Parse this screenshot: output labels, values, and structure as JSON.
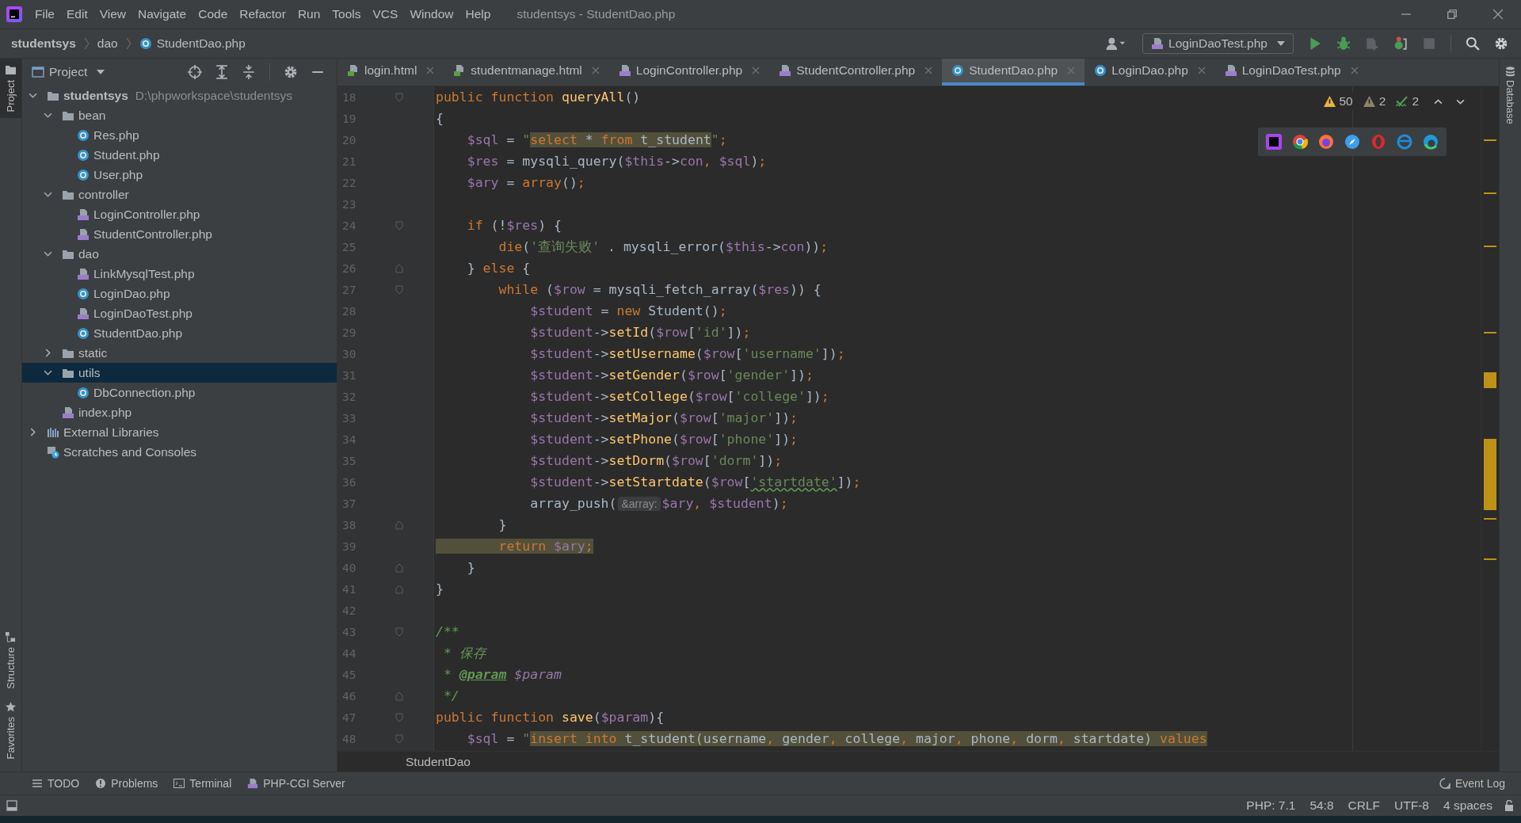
{
  "window": {
    "menu": [
      "File",
      "Edit",
      "View",
      "Navigate",
      "Code",
      "Refactor",
      "Run",
      "Tools",
      "VCS",
      "Window",
      "Help"
    ],
    "title": "studentsys - StudentDao.php"
  },
  "navbar": {
    "breadcrumbs": [
      {
        "label": "studentsys",
        "kind": "project"
      },
      {
        "label": "dao",
        "kind": "folder"
      },
      {
        "label": "StudentDao.php",
        "kind": "class"
      }
    ],
    "run_config": "LoginDaoTest.php"
  },
  "left_strip": [
    {
      "label": "Project",
      "kind": "project",
      "selected": true
    },
    {
      "label": "Structure",
      "kind": "structure",
      "selected": false
    },
    {
      "label": "Favorites",
      "kind": "favorites",
      "selected": false
    }
  ],
  "right_strip": [
    {
      "label": "Database",
      "kind": "database"
    }
  ],
  "project_panel": {
    "title": "Project",
    "tree": [
      {
        "label": "studentsys",
        "hint": "D:\\phpworkspace\\studentsys",
        "kind": "folder",
        "expanded": true,
        "selected": false,
        "children": [
          {
            "label": "bean",
            "kind": "folder",
            "expanded": true,
            "selected": false,
            "children": [
              {
                "label": "Res.php",
                "kind": "class",
                "selected": false
              },
              {
                "label": "Student.php",
                "kind": "class",
                "selected": false
              },
              {
                "label": "User.php",
                "kind": "class",
                "selected": false
              }
            ]
          },
          {
            "label": "controller",
            "kind": "folder",
            "expanded": true,
            "selected": false,
            "children": [
              {
                "label": "LoginController.php",
                "kind": "php",
                "selected": false
              },
              {
                "label": "StudentController.php",
                "kind": "php",
                "selected": false
              }
            ]
          },
          {
            "label": "dao",
            "kind": "folder",
            "expanded": true,
            "selected": false,
            "children": [
              {
                "label": "LinkMysqlTest.php",
                "kind": "php",
                "selected": false
              },
              {
                "label": "LoginDao.php",
                "kind": "class",
                "selected": false
              },
              {
                "label": "LoginDaoTest.php",
                "kind": "php",
                "selected": false
              },
              {
                "label": "StudentDao.php",
                "kind": "class",
                "selected": false
              }
            ]
          },
          {
            "label": "static",
            "kind": "folder",
            "expanded": false,
            "selected": false
          },
          {
            "label": "utils",
            "kind": "folder",
            "expanded": true,
            "selected": true,
            "children": [
              {
                "label": "DbConnection.php",
                "kind": "class",
                "selected": false
              }
            ]
          },
          {
            "label": "index.php",
            "kind": "php",
            "selected": false
          }
        ]
      },
      {
        "label": "External Libraries",
        "kind": "libraries",
        "expanded": false,
        "selected": false
      },
      {
        "label": "Scratches and Consoles",
        "kind": "scratches",
        "selected": false
      }
    ]
  },
  "editor_tabs": [
    {
      "label": "login.html",
      "kind": "html",
      "selected": false
    },
    {
      "label": "studentmanage.html",
      "kind": "html",
      "selected": false
    },
    {
      "label": "LoginController.php",
      "kind": "php",
      "selected": false
    },
    {
      "label": "StudentController.php",
      "kind": "php",
      "selected": false
    },
    {
      "label": "StudentDao.php",
      "kind": "class",
      "selected": true
    },
    {
      "label": "LoginDao.php",
      "kind": "class",
      "selected": false
    },
    {
      "label": "LoginDaoTest.php",
      "kind": "php",
      "selected": false
    }
  ],
  "inspections": [
    {
      "kind": "warning",
      "count": "50"
    },
    {
      "kind": "weak",
      "count": "2"
    },
    {
      "kind": "typo",
      "count": "2"
    }
  ],
  "code": [
    {
      "number": "18",
      "fold_start": true,
      "tokens": [
        {
          "text": "public",
          "kind": "kw"
        },
        {
          "text": " function",
          "kind": "kw"
        },
        {
          "text": " queryAll",
          "kind": "fn"
        },
        {
          "text": "()"
        }
      ]
    },
    {
      "number": "19",
      "tokens": [
        {
          "text": "{"
        }
      ]
    },
    {
      "number": "20",
      "tokens": [
        {
          "text": "    $sql",
          "kind": "var"
        },
        {
          "text": " = "
        },
        {
          "text": "\"",
          "kind": "str"
        },
        {
          "text": "select",
          "kind": "kw",
          "hl": true
        },
        {
          "text": " * ",
          "hl": true
        },
        {
          "text": "from",
          "kind": "kw",
          "hl": true
        },
        {
          "text": " t_student",
          "hl": true
        },
        {
          "text": "\"",
          "kind": "str"
        },
        {
          "text": ";",
          "kind": "punct"
        }
      ]
    },
    {
      "number": "21",
      "tokens": [
        {
          "text": "    $res",
          "kind": "var"
        },
        {
          "text": " = mysqli_query("
        },
        {
          "text": "$this",
          "kind": "var"
        },
        {
          "text": "->"
        },
        {
          "text": "con",
          "kind": "var"
        },
        {
          "text": ",",
          "kind": "punct"
        },
        {
          "text": " $sql",
          "kind": "var"
        },
        {
          "text": ")"
        },
        {
          "text": ";",
          "kind": "punct"
        }
      ]
    },
    {
      "number": "22",
      "tokens": [
        {
          "text": "    $ary",
          "kind": "var"
        },
        {
          "text": " = "
        },
        {
          "text": "array",
          "kind": "kw"
        },
        {
          "text": "()"
        },
        {
          "text": ";",
          "kind": "punct"
        }
      ]
    },
    {
      "number": "23"
    },
    {
      "number": "24",
      "fold_start": true,
      "tokens": [
        {
          "text": "    if",
          "kind": "kw"
        },
        {
          "text": " (!"
        },
        {
          "text": "$res",
          "kind": "var"
        },
        {
          "text": ") {"
        }
      ]
    },
    {
      "number": "25",
      "tokens": [
        {
          "text": "        die",
          "kind": "kw"
        },
        {
          "text": "("
        },
        {
          "text": "'查询失败'",
          "kind": "str"
        },
        {
          "text": " . mysqli_error("
        },
        {
          "text": "$this",
          "kind": "var"
        },
        {
          "text": "->"
        },
        {
          "text": "con",
          "kind": "var"
        },
        {
          "text": "))"
        },
        {
          "text": ";",
          "kind": "punct"
        }
      ]
    },
    {
      "number": "26",
      "fold_end": true,
      "tokens": [
        {
          "text": "    }"
        },
        {
          "text": " else",
          "kind": "kw"
        },
        {
          "text": " {"
        }
      ]
    },
    {
      "number": "27",
      "fold_start": true,
      "tokens": [
        {
          "text": "        while",
          "kind": "kw"
        },
        {
          "text": " ("
        },
        {
          "text": "$row",
          "kind": "var"
        },
        {
          "text": " = mysqli_fetch_array("
        },
        {
          "text": "$res",
          "kind": "var"
        },
        {
          "text": ")) {"
        }
      ]
    },
    {
      "number": "28",
      "tokens": [
        {
          "text": "            $student",
          "kind": "var"
        },
        {
          "text": " = "
        },
        {
          "text": "new",
          "kind": "kw"
        },
        {
          "text": " Student()"
        },
        {
          "text": ";",
          "kind": "punct"
        }
      ]
    },
    {
      "number": "29",
      "tokens": [
        {
          "text": "            $student",
          "kind": "var"
        },
        {
          "text": "->"
        },
        {
          "text": "setId",
          "kind": "fn"
        },
        {
          "text": "("
        },
        {
          "text": "$row",
          "kind": "var"
        },
        {
          "text": "["
        },
        {
          "text": "'id'",
          "kind": "str"
        },
        {
          "text": "])"
        },
        {
          "text": ";",
          "kind": "punct"
        }
      ]
    },
    {
      "number": "30",
      "tokens": [
        {
          "text": "            $student",
          "kind": "var"
        },
        {
          "text": "->"
        },
        {
          "text": "setUsername",
          "kind": "fn"
        },
        {
          "text": "("
        },
        {
          "text": "$row",
          "kind": "var"
        },
        {
          "text": "["
        },
        {
          "text": "'username'",
          "kind": "str"
        },
        {
          "text": "])"
        },
        {
          "text": ";",
          "kind": "punct"
        }
      ]
    },
    {
      "number": "31",
      "tokens": [
        {
          "text": "            $student",
          "kind": "var"
        },
        {
          "text": "->"
        },
        {
          "text": "setGender",
          "kind": "fn"
        },
        {
          "text": "("
        },
        {
          "text": "$row",
          "kind": "var"
        },
        {
          "text": "["
        },
        {
          "text": "'gender'",
          "kind": "str"
        },
        {
          "text": "])"
        },
        {
          "text": ";",
          "kind": "punct"
        }
      ]
    },
    {
      "number": "32",
      "tokens": [
        {
          "text": "            $student",
          "kind": "var"
        },
        {
          "text": "->"
        },
        {
          "text": "setCollege",
          "kind": "fn"
        },
        {
          "text": "("
        },
        {
          "text": "$row",
          "kind": "var"
        },
        {
          "text": "["
        },
        {
          "text": "'college'",
          "kind": "str"
        },
        {
          "text": "])"
        },
        {
          "text": ";",
          "kind": "punct"
        }
      ]
    },
    {
      "number": "33",
      "tokens": [
        {
          "text": "            $student",
          "kind": "var"
        },
        {
          "text": "->"
        },
        {
          "text": "setMajor",
          "kind": "fn"
        },
        {
          "text": "("
        },
        {
          "text": "$row",
          "kind": "var"
        },
        {
          "text": "["
        },
        {
          "text": "'major'",
          "kind": "str"
        },
        {
          "text": "])"
        },
        {
          "text": ";",
          "kind": "punct"
        }
      ]
    },
    {
      "number": "34",
      "tokens": [
        {
          "text": "            $student",
          "kind": "var"
        },
        {
          "text": "->"
        },
        {
          "text": "setPhone",
          "kind": "fn"
        },
        {
          "text": "("
        },
        {
          "text": "$row",
          "kind": "var"
        },
        {
          "text": "["
        },
        {
          "text": "'phone'",
          "kind": "str"
        },
        {
          "text": "])"
        },
        {
          "text": ";",
          "kind": "punct"
        }
      ]
    },
    {
      "number": "35",
      "tokens": [
        {
          "text": "            $student",
          "kind": "var"
        },
        {
          "text": "->"
        },
        {
          "text": "setDorm",
          "kind": "fn"
        },
        {
          "text": "("
        },
        {
          "text": "$row",
          "kind": "var"
        },
        {
          "text": "["
        },
        {
          "text": "'dorm'",
          "kind": "str"
        },
        {
          "text": "])"
        },
        {
          "text": ";",
          "kind": "punct"
        }
      ]
    },
    {
      "number": "36",
      "tokens": [
        {
          "text": "            $student",
          "kind": "var"
        },
        {
          "text": "->"
        },
        {
          "text": "setStartdate",
          "kind": "fn"
        },
        {
          "text": "("
        },
        {
          "text": "$row",
          "kind": "var"
        },
        {
          "text": "["
        },
        {
          "text": "'startdate'",
          "kind": "str",
          "typo": true
        },
        {
          "text": "])"
        },
        {
          "text": ";",
          "kind": "punct"
        }
      ]
    },
    {
      "number": "37",
      "tokens": [
        {
          "text": "            array_push("
        },
        {
          "text": "&array:",
          "kind": "hint"
        },
        {
          "text": "$ary",
          "kind": "var"
        },
        {
          "text": ",",
          "kind": "punct"
        },
        {
          "text": " $student",
          "kind": "var"
        },
        {
          "text": ")"
        },
        {
          "text": ";",
          "kind": "punct"
        }
      ]
    },
    {
      "number": "38",
      "fold_end": true,
      "tokens": [
        {
          "text": "        }"
        }
      ]
    },
    {
      "number": "39",
      "tokens": [
        {
          "text": "        return",
          "kind": "kw",
          "hl": true
        },
        {
          "text": " $ary",
          "kind": "var",
          "hl": true
        },
        {
          "text": ";",
          "kind": "punct",
          "hl": true
        }
      ]
    },
    {
      "number": "40",
      "fold_end": true,
      "tokens": [
        {
          "text": "    }"
        }
      ]
    },
    {
      "number": "41",
      "fold_end": true,
      "tokens": [
        {
          "text": "}"
        }
      ]
    },
    {
      "number": "42"
    },
    {
      "number": "43",
      "fold_start": true,
      "tokens": [
        {
          "text": "/**",
          "kind": "doc"
        }
      ]
    },
    {
      "number": "44",
      "tokens": [
        {
          "text": " * 保存",
          "kind": "doc"
        }
      ]
    },
    {
      "number": "45",
      "tokens": [
        {
          "text": " * ",
          "kind": "doc"
        },
        {
          "text": "@param",
          "kind": "doctag"
        },
        {
          "text": " $param",
          "kind": "docvar"
        }
      ]
    },
    {
      "number": "46",
      "fold_end": true,
      "tokens": [
        {
          "text": " */",
          "kind": "doc"
        }
      ]
    },
    {
      "number": "47",
      "fold_start": true,
      "tokens": [
        {
          "text": "public",
          "kind": "kw"
        },
        {
          "text": " function",
          "kind": "kw"
        },
        {
          "text": " save",
          "kind": "fn"
        },
        {
          "text": "("
        },
        {
          "text": "$param",
          "kind": "var"
        },
        {
          "text": "){"
        }
      ]
    },
    {
      "number": "48",
      "fold_start": true,
      "tokens": [
        {
          "text": "    $sql",
          "kind": "var"
        },
        {
          "text": " = "
        },
        {
          "text": "\"",
          "kind": "str"
        },
        {
          "text": "insert",
          "kind": "kw",
          "hl": true
        },
        {
          "text": " into",
          "kind": "kw",
          "hl": true
        },
        {
          "text": " t_student(username",
          "hl": true
        },
        {
          "text": ",",
          "kind": "punct",
          "hl": true
        },
        {
          "text": " gender",
          "hl": true
        },
        {
          "text": ",",
          "kind": "punct",
          "hl": true
        },
        {
          "text": " college",
          "hl": true
        },
        {
          "text": ",",
          "kind": "punct",
          "hl": true
        },
        {
          "text": " major",
          "hl": true
        },
        {
          "text": ",",
          "kind": "punct",
          "hl": true
        },
        {
          "text": " phone",
          "hl": true
        },
        {
          "text": ",",
          "kind": "punct",
          "hl": true
        },
        {
          "text": " dorm",
          "hl": true
        },
        {
          "text": ",",
          "kind": "punct",
          "hl": true
        },
        {
          "text": " startdate)",
          "hl": true
        },
        {
          "text": " values",
          "kind": "kw",
          "hl": true
        }
      ]
    }
  ],
  "editor_breadcrumb": "StudentDao",
  "tool_windows": [
    {
      "label": "TODO",
      "kind": "todo"
    },
    {
      "label": "Problems",
      "kind": "problems"
    },
    {
      "label": "Terminal",
      "kind": "terminal"
    },
    {
      "label": "PHP-CGI Server",
      "kind": "server"
    }
  ],
  "event_log": "Event Log",
  "status_bar": [
    "PHP: 7.1",
    "54:8",
    "CRLF",
    "UTF-8",
    "4 spaces"
  ]
}
